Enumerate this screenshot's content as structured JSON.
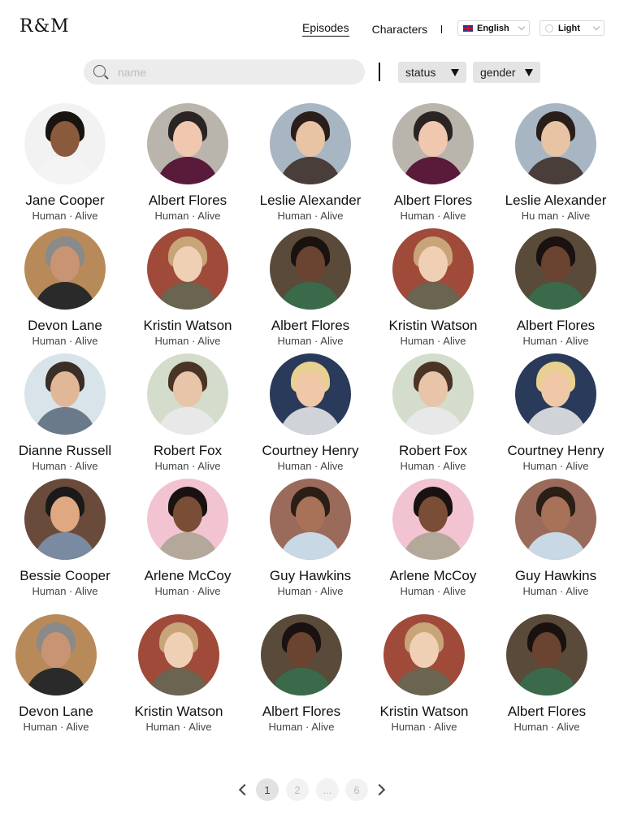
{
  "app": {
    "logo": "R&M"
  },
  "nav": {
    "episodes": "Episodes",
    "characters": "Characters"
  },
  "language": {
    "selected": "English"
  },
  "theme": {
    "selected": "Light"
  },
  "search": {
    "placeholder": "name",
    "value": ""
  },
  "filters": {
    "status": "status",
    "gender": "gender"
  },
  "colors": {
    "selected_page": "#e2e2e2",
    "filter_bg": "#e4e4e4",
    "search_bg": "#ececec"
  },
  "characters": [
    {
      "name": "Jane Cooper",
      "subtitle": "Human · Alive",
      "bg": "#f2f2f2",
      "skin": "#8a5a3c",
      "hair": "#1a1410",
      "shirt": "#f4f4f4"
    },
    {
      "name": "Albert Flores",
      "subtitle": "Human · Alive",
      "bg": "#b9b4ac",
      "skin": "#f0c8b0",
      "hair": "#2a2522",
      "shirt": "#5a1a3a"
    },
    {
      "name": "Leslie Alexander",
      "subtitle": "Human · Alive",
      "bg": "#a8b6c4",
      "skin": "#e8c4a4",
      "hair": "#2a1e1a",
      "shirt": "#4a3e3a"
    },
    {
      "name": "Albert Flores",
      "subtitle": "Human · Alive",
      "bg": "#b9b4ac",
      "skin": "#f0c8b0",
      "hair": "#2a2522",
      "shirt": "#5a1a3a"
    },
    {
      "name": "Leslie Alexander",
      "subtitle": "Hu man · Alive",
      "bg": "#a8b6c4",
      "skin": "#e8c4a4",
      "hair": "#2a1e1a",
      "shirt": "#4a3e3a"
    },
    {
      "name": "Devon Lane",
      "subtitle": "Human · Alive",
      "bg": "#b88a5a",
      "skin": "#c89474",
      "hair": "#8a8a8a",
      "shirt": "#2a2a2a"
    },
    {
      "name": "Kristin Watson",
      "subtitle": "Human · Alive",
      "bg": "#a04a3a",
      "skin": "#f0d0b4",
      "hair": "#c8a478",
      "shirt": "#6a6450"
    },
    {
      "name": "Albert Flores",
      "subtitle": "Human · Alive",
      "bg": "#5a4a3a",
      "skin": "#6a4430",
      "hair": "#1a1210",
      "shirt": "#3a6a4a"
    },
    {
      "name": "Kristin Watson",
      "subtitle": "Human · Alive",
      "bg": "#a04a3a",
      "skin": "#f0d0b4",
      "hair": "#c8a478",
      "shirt": "#6a6450"
    },
    {
      "name": "Albert Flores",
      "subtitle": "Human · Alive",
      "bg": "#5a4a3a",
      "skin": "#6a4430",
      "hair": "#1a1210",
      "shirt": "#3a6a4a"
    },
    {
      "name": "Dianne Russell",
      "subtitle": "Human · Alive",
      "bg": "#d8e4ea",
      "skin": "#e0b898",
      "hair": "#3a2e26",
      "shirt": "#6a7a8a"
    },
    {
      "name": "Robert Fox",
      "subtitle": "Human · Alive",
      "bg": "#d4dccc",
      "skin": "#e8c4a8",
      "hair": "#4a3426",
      "shirt": "#e8e8e8"
    },
    {
      "name": "Courtney Henry",
      "subtitle": "Human · Alive",
      "bg": "#2a3a5a",
      "skin": "#f0c8a8",
      "hair": "#e8d090",
      "shirt": "#d0d4d8"
    },
    {
      "name": "Robert Fox",
      "subtitle": "Human · Alive",
      "bg": "#d4dccc",
      "skin": "#e8c4a8",
      "hair": "#4a3426",
      "shirt": "#e8e8e8"
    },
    {
      "name": "Courtney Henry",
      "subtitle": "Human · Alive",
      "bg": "#2a3a5a",
      "skin": "#f0c8a8",
      "hair": "#e8d090",
      "shirt": "#d0d4d8"
    },
    {
      "name": "Bessie Cooper",
      "subtitle": "Human · Alive",
      "bg": "#6a4a3a",
      "skin": "#e0a880",
      "hair": "#1a1a1a",
      "shirt": "#7a8aa0"
    },
    {
      "name": "Arlene McCoy",
      "subtitle": "Human · Alive",
      "bg": "#f2c4d2",
      "skin": "#7a4e36",
      "hair": "#1a1210",
      "shirt": "#b4a89a"
    },
    {
      "name": "Guy Hawkins",
      "subtitle": "Human · Alive",
      "bg": "#9a6a5a",
      "skin": "#a87258",
      "hair": "#2a1e16",
      "shirt": "#c8d8e4"
    },
    {
      "name": "Arlene McCoy",
      "subtitle": "Human · Alive",
      "bg": "#f2c4d2",
      "skin": "#7a4e36",
      "hair": "#1a1210",
      "shirt": "#b4a89a"
    },
    {
      "name": "Guy Hawkins",
      "subtitle": "Human · Alive",
      "bg": "#9a6a5a",
      "skin": "#a87258",
      "hair": "#2a1e16",
      "shirt": "#c8d8e4"
    },
    {
      "name": "Devon Lane",
      "subtitle": "Human · Alive",
      "bg": "#b88a5a",
      "skin": "#c89474",
      "hair": "#8a8a8a",
      "shirt": "#2a2a2a"
    },
    {
      "name": "Kristin Watson",
      "subtitle": "Human · Alive",
      "bg": "#a04a3a",
      "skin": "#f0d0b4",
      "hair": "#c8a478",
      "shirt": "#6a6450"
    },
    {
      "name": "Albert Flores",
      "subtitle": "Human · Alive",
      "bg": "#5a4a3a",
      "skin": "#6a4430",
      "hair": "#1a1210",
      "shirt": "#3a6a4a"
    },
    {
      "name": "Kristin Watson",
      "subtitle": "Human · Alive",
      "bg": "#a04a3a",
      "skin": "#f0d0b4",
      "hair": "#c8a478",
      "shirt": "#6a6450"
    },
    {
      "name": "Albert Flores",
      "subtitle": "Human · Alive",
      "bg": "#5a4a3a",
      "skin": "#6a4430",
      "hair": "#1a1210",
      "shirt": "#3a6a4a"
    }
  ],
  "pagination": {
    "prev_icon": "chevron-left-icon",
    "next_icon": "chevron-right-icon",
    "pages": [
      "1",
      "2",
      "...",
      "6"
    ],
    "current": "1"
  }
}
